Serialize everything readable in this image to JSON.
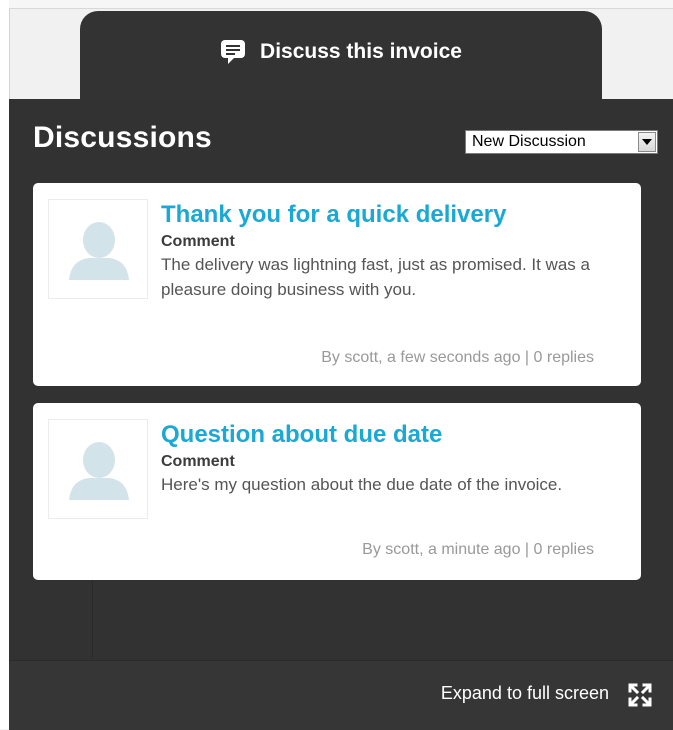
{
  "tab": {
    "label": "Discuss this invoice",
    "icon": "chat-bubble-icon"
  },
  "panel": {
    "title": "Discussions",
    "new_discussion_select": {
      "value": "New Discussion",
      "icon": "dropdown-arrow-icon"
    }
  },
  "discussions": [
    {
      "title": "Thank you for a quick delivery",
      "type": "Comment",
      "text": "The delivery was lightning fast, just as promised. It was a pleasure doing business with you.",
      "meta": "By scott, a few seconds ago | 0 replies"
    },
    {
      "title": "Question about due date",
      "type": "Comment",
      "text": "Here's my question about the due date of the invoice.",
      "meta": "By scott, a minute ago | 0 replies"
    }
  ],
  "footer": {
    "expand_label": "Expand to full screen",
    "icon": "expand-fullscreen-icon"
  },
  "colors": {
    "panel_bg": "#323232",
    "title_link": "#1aa8d4",
    "avatar_placeholder": "#d3e3ea"
  }
}
